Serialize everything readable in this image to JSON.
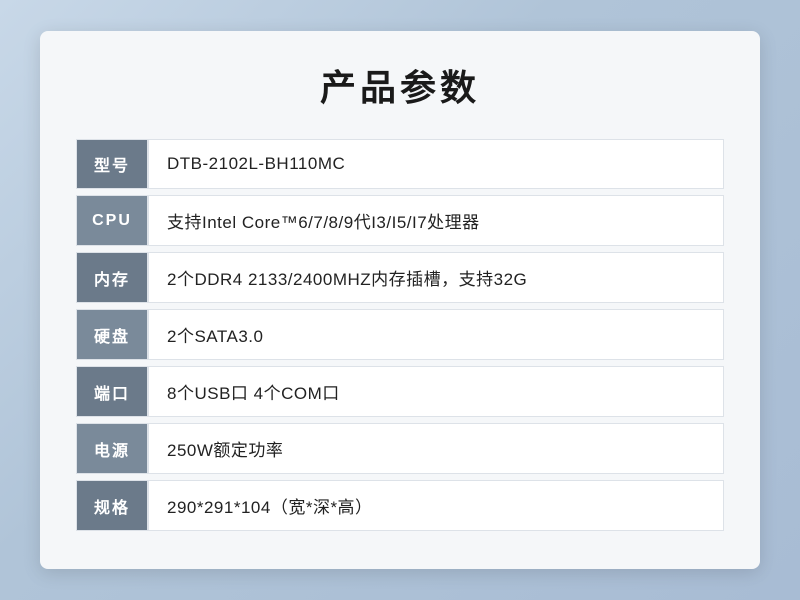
{
  "page": {
    "title": "产品参数",
    "background": "#c8d8e8"
  },
  "specs": [
    {
      "label": "型号",
      "value": " DTB-2102L-BH110MC"
    },
    {
      "label": "CPU",
      "value": "支持Intel Core™6/7/8/9代I3/I5/I7处理器"
    },
    {
      "label": "内存",
      "value": "2个DDR4 2133/2400MHZ内存插槽，支持32G"
    },
    {
      "label": "硬盘",
      "value": "2个SATA3.0"
    },
    {
      "label": "端口",
      "value": "8个USB口 4个COM口"
    },
    {
      "label": "电源",
      "value": "250W额定功率"
    },
    {
      "label": "规格",
      "value": "290*291*104（宽*深*高）"
    }
  ]
}
